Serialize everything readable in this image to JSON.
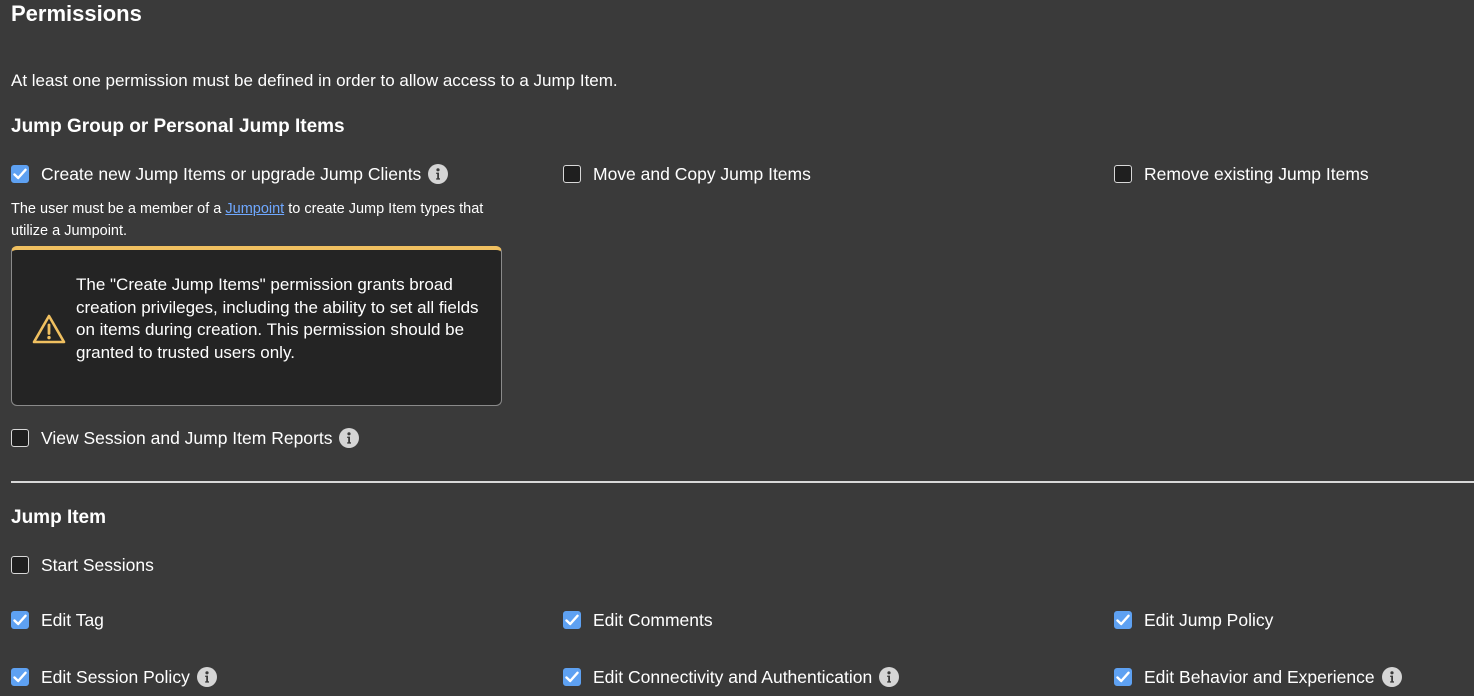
{
  "page": {
    "title": "Permissions",
    "intro": "At least one permission must be defined in order to allow access to a Jump Item."
  },
  "jump_group_section": {
    "heading": "Jump Group or Personal Jump Items",
    "create_items": {
      "label": "Create new Jump Items or upgrade Jump Clients",
      "checked": true
    },
    "move_copy": {
      "label": "Move and Copy Jump Items",
      "checked": false
    },
    "remove_items": {
      "label": "Remove existing Jump Items",
      "checked": false
    },
    "note_prefix": "The user must be a member of a ",
    "note_link": "Jumpoint",
    "note_suffix": " to create Jump Item types that utilize a Jumpoint.",
    "warning": {
      "icon": "warning-icon",
      "text": "The \"Create Jump Items\" permission grants broad creation privileges, including the ability to set all fields on items during creation. This permission should be granted to trusted users only.",
      "accent_color": "#f0c060"
    },
    "view_reports": {
      "label": "View Session and Jump Item Reports",
      "checked": false
    }
  },
  "jump_item_section": {
    "heading": "Jump Item",
    "start_sessions": {
      "label": "Start Sessions",
      "checked": false
    },
    "edit_tag": {
      "label": "Edit Tag",
      "checked": true
    },
    "edit_comments": {
      "label": "Edit Comments",
      "checked": true
    },
    "edit_jump_policy": {
      "label": "Edit Jump Policy",
      "checked": true
    },
    "edit_session_policy": {
      "label": "Edit Session Policy",
      "checked": true
    },
    "edit_connectivity": {
      "label": "Edit Connectivity and Authentication",
      "checked": true
    },
    "edit_behavior": {
      "label": "Edit Behavior and Experience",
      "checked": true
    }
  },
  "colors": {
    "background": "#3a3a3a",
    "checkbox_checked": "#5ea1f2",
    "link": "#6fa8ff"
  }
}
